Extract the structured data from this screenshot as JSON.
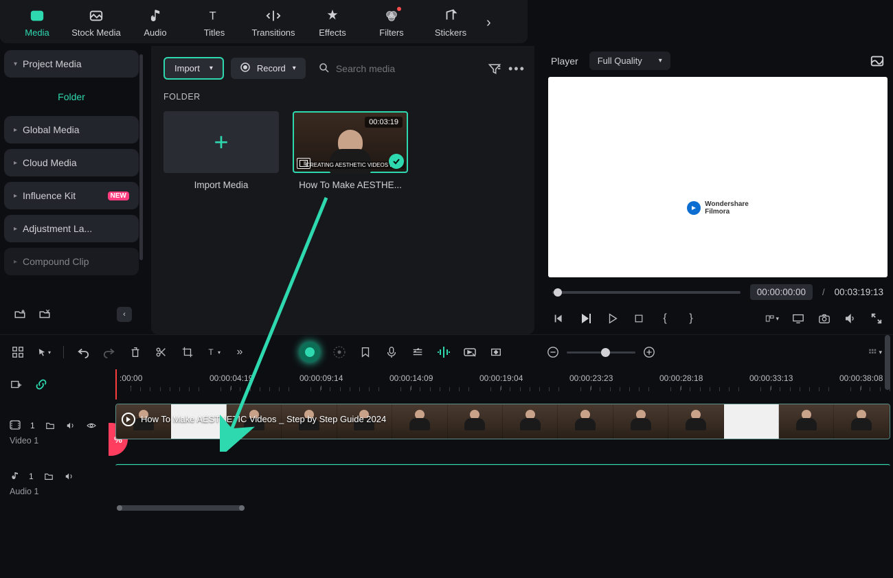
{
  "tabs": {
    "items": [
      {
        "label": "Media",
        "icon": "media"
      },
      {
        "label": "Stock Media",
        "icon": "stock"
      },
      {
        "label": "Audio",
        "icon": "audio"
      },
      {
        "label": "Titles",
        "icon": "titles"
      },
      {
        "label": "Transitions",
        "icon": "transitions"
      },
      {
        "label": "Effects",
        "icon": "effects"
      },
      {
        "label": "Filters",
        "icon": "filters"
      },
      {
        "label": "Stickers",
        "icon": "stickers"
      }
    ]
  },
  "sidebar": {
    "project_media": "Project Media",
    "folder": "Folder",
    "items": [
      {
        "label": "Global Media"
      },
      {
        "label": "Cloud Media"
      },
      {
        "label": "Influence Kit",
        "new": true
      },
      {
        "label": "Adjustment La..."
      },
      {
        "label": "Compound Clip"
      }
    ]
  },
  "media": {
    "import_btn": "Import",
    "record_btn": "Record",
    "search_placeholder": "Search media",
    "folder_header": "FOLDER",
    "import_tile": "Import Media",
    "clip": {
      "duration": "00:03:19",
      "title": "How To Make AESTHE..."
    }
  },
  "player": {
    "title": "Player",
    "quality": "Full Quality",
    "watermark_brand": "Wondershare",
    "watermark_product": "Filmora",
    "time_current": "00:00:00:00",
    "time_separator": "/",
    "time_total": "00:03:19:13"
  },
  "timeline": {
    "ruler": [
      ":00:00",
      "00:00:04:19",
      "00:00:09:14",
      "00:00:14:09",
      "00:00:19:04",
      "00:00:23:23",
      "00:00:28:18",
      "00:00:33:13",
      "00:00:38:08"
    ],
    "video_track": {
      "index": "1",
      "label": "Video 1"
    },
    "audio_track": {
      "index": "1",
      "label": "Audio 1"
    },
    "clip_name": "How To Make AESTHETIC Videos _ Step by Step Guide 2024",
    "cut_symbol": "%"
  }
}
